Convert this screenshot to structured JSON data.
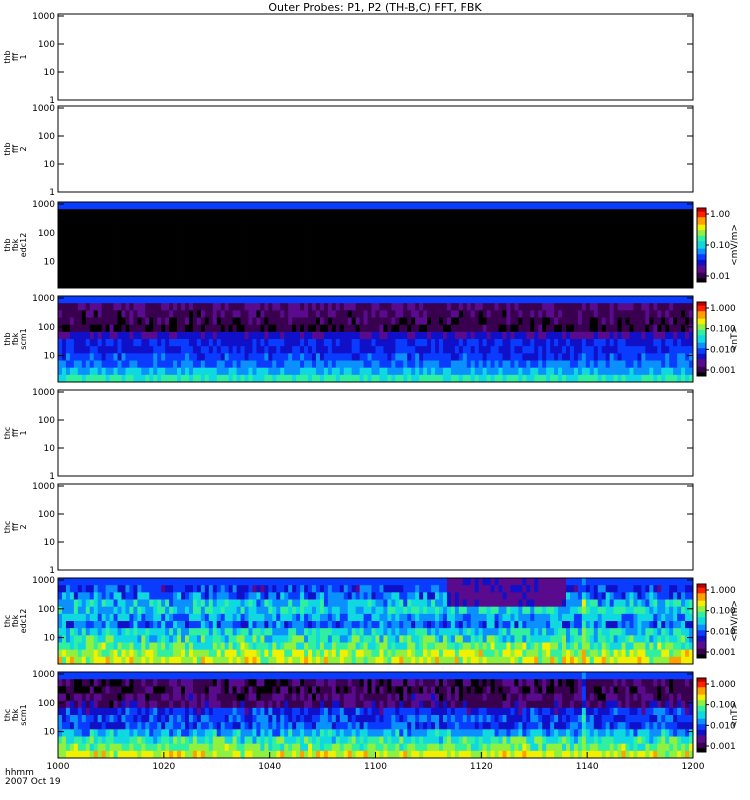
{
  "chart_data": {
    "type": "heatmap",
    "title": "Outer Probes: P1, P2 (TH-B,C) FFT, FBK",
    "x_ticks": [
      "1000",
      "1020",
      "1040",
      "1100",
      "1120",
      "1140",
      "1200"
    ],
    "x_footer": {
      "line1": "hhmm",
      "line2": "2007 Oct 19"
    },
    "colormap": [
      "#000000",
      "#3a0050",
      "#5a0a8c",
      "#1010c8",
      "#0a3cff",
      "#0a90ff",
      "#10d8e0",
      "#30f0a0",
      "#90f040",
      "#f0f000",
      "#ffa000",
      "#ff2000",
      "#c00000"
    ],
    "panels": [
      {
        "label": [
          "thb",
          "fff",
          "1"
        ],
        "kind": "empty",
        "yticks": [
          "1000",
          "100",
          "10",
          "1"
        ]
      },
      {
        "label": [
          "thb",
          "fff",
          "2"
        ],
        "kind": "empty",
        "yticks": [
          "1000",
          "100",
          "10",
          "1"
        ]
      },
      {
        "label": [
          "thb",
          "fbk",
          "edc12"
        ],
        "kind": "spectrogram",
        "yticks": [
          "1000",
          "100",
          "10"
        ],
        "colorbar": {
          "unit": "<mV/m>",
          "ticks": [
            "1.00",
            "0.10",
            "0.01"
          ]
        },
        "profile": [
          0.35,
          0.02,
          0.02,
          0.02,
          0.02,
          0.02,
          0.02,
          0.02,
          0.02,
          0.02,
          0.02,
          0.02
        ],
        "noise": 0.02
      },
      {
        "label": [
          "thb",
          "fbk",
          "scm1"
        ],
        "kind": "spectrogram",
        "yticks": [
          "1000",
          "100",
          "10"
        ],
        "colorbar": {
          "unit": "<nT>",
          "ticks": [
            "1.000",
            "0.100",
            "0.010",
            "0.001"
          ]
        },
        "profile": [
          0.3,
          0.12,
          0.1,
          0.08,
          0.06,
          0.22,
          0.28,
          0.28,
          0.33,
          0.38,
          0.45,
          0.55
        ],
        "noise": 0.07
      },
      {
        "label": [
          "thc",
          "fff",
          "1"
        ],
        "kind": "empty",
        "yticks": [
          "1000",
          "100",
          "10",
          "1"
        ]
      },
      {
        "label": [
          "thc",
          "fff",
          "2"
        ],
        "kind": "empty",
        "yticks": [
          "1000",
          "100",
          "10",
          "1"
        ]
      },
      {
        "label": [
          "thc",
          "fbk",
          "edc12"
        ],
        "kind": "spectrogram",
        "yticks": [
          "1000",
          "100",
          "10"
        ],
        "colorbar": {
          "unit": "<mV/m>",
          "ticks": [
            "1.000",
            "0.100",
            "0.010",
            "0.001"
          ]
        },
        "profile": [
          0.3,
          0.32,
          0.38,
          0.48,
          0.5,
          0.42,
          0.38,
          0.5,
          0.55,
          0.6,
          0.68,
          0.72
        ],
        "noise": 0.12
      },
      {
        "label": [
          "thc",
          "fbk",
          "scm1"
        ],
        "kind": "spectrogram",
        "yticks": [
          "1000",
          "100",
          "10"
        ],
        "colorbar": {
          "unit": "<nT>",
          "ticks": [
            "1.000",
            "0.100",
            "0.010",
            "0.001"
          ]
        },
        "profile": [
          0.3,
          0.1,
          0.08,
          0.12,
          0.14,
          0.3,
          0.33,
          0.34,
          0.45,
          0.55,
          0.62,
          0.72
        ],
        "noise": 0.1
      }
    ]
  }
}
